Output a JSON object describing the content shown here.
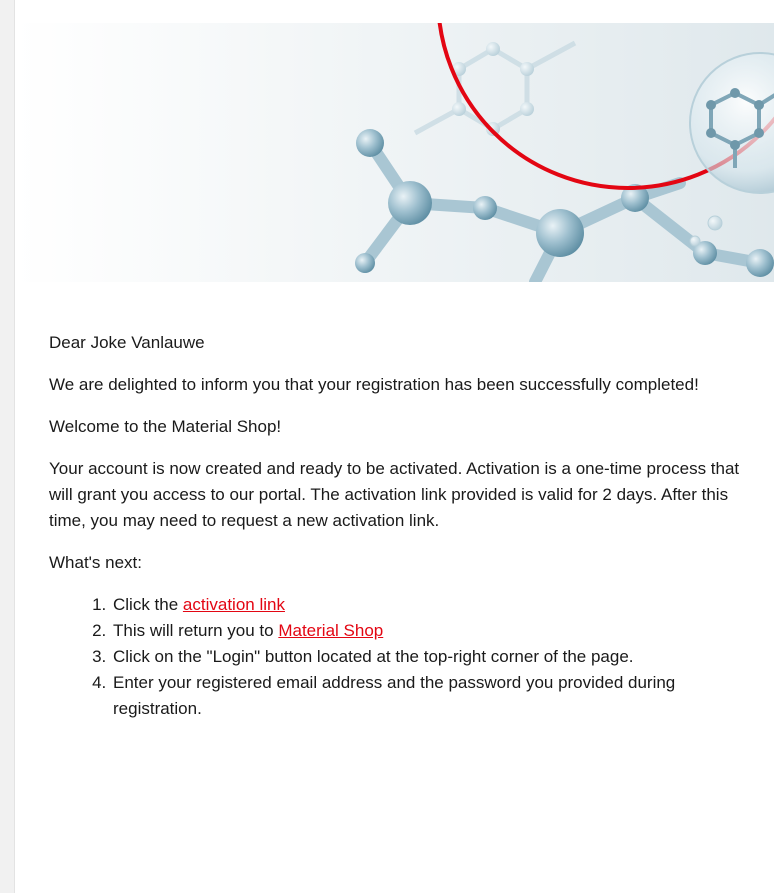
{
  "colors": {
    "brand_red": "#e30613",
    "text": "#1a1a1a",
    "hero_bg": "#eef3f5",
    "molecule": "#8fb4c4"
  },
  "hero": {
    "image": "molecule-banner",
    "accent": "red-circle-arc"
  },
  "email": {
    "greeting": "Dear Joke Vanlauwe",
    "confirmation": "We are delighted to inform you that your registration has been successfully completed!",
    "welcome": "Welcome to the Material Shop!",
    "account_info": "Your account is now created and ready to be activated. Activation is a one-time process that will grant you access to our portal. The activation link provided is valid for 2 days. After this time, you may need to request a new activation link.",
    "next_heading": "What's next:",
    "steps": [
      {
        "prefix": "Click the ",
        "link": "activation link",
        "suffix": ""
      },
      {
        "prefix": "This will return you to ",
        "link": "Material Shop",
        "suffix": ""
      },
      {
        "text": "Click on the \"Login\" button located at the top-right corner of the page."
      },
      {
        "text": "Enter your registered email address and the password you provided during registration."
      }
    ]
  }
}
